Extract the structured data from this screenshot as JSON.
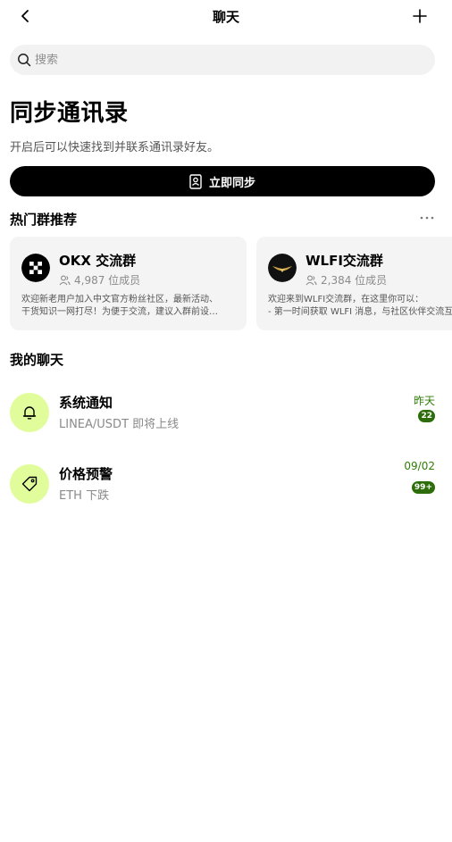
{
  "header": {
    "title": "聊天"
  },
  "search": {
    "placeholder": "搜索"
  },
  "sync": {
    "title": "同步通讯录",
    "description": "开启后可以快速找到并联系通讯录好友。",
    "button_label": "立即同步"
  },
  "hot_groups": {
    "title": "热门群推荐",
    "cards": [
      {
        "name": "OKX 交流群",
        "members": "4,987 位成员",
        "desc_line1": "欢迎新老用户加入中文官方粉丝社区，最新活动、",
        "desc_line2": "干货知识一网打尽！为便于交流，建议入群前设…"
      },
      {
        "name": "WLFI交流群",
        "members": "2,384 位成员",
        "desc_line1": "欢迎来到WLFI交流群，在这里你可以：",
        "desc_line2": "- 第一时间获取 WLFI 消息，与社区伙伴交流互动"
      }
    ]
  },
  "my_chats": {
    "title": "我的聊天",
    "items": [
      {
        "name": "系统通知",
        "preview": "LINEA/USDT 即将上线",
        "time": "昨天",
        "badge": "22",
        "icon": "bell-icon"
      },
      {
        "name": "价格预警",
        "preview": "ETH 下跌",
        "time": "09/02",
        "badge": "99+",
        "icon": "price-tag-icon"
      }
    ]
  },
  "colors": {
    "accent_green": "#2c6d0a",
    "avatar_bg": "#e1fd9b",
    "card_bg": "#f4f4f4",
    "search_bg": "#f2f2f2"
  }
}
